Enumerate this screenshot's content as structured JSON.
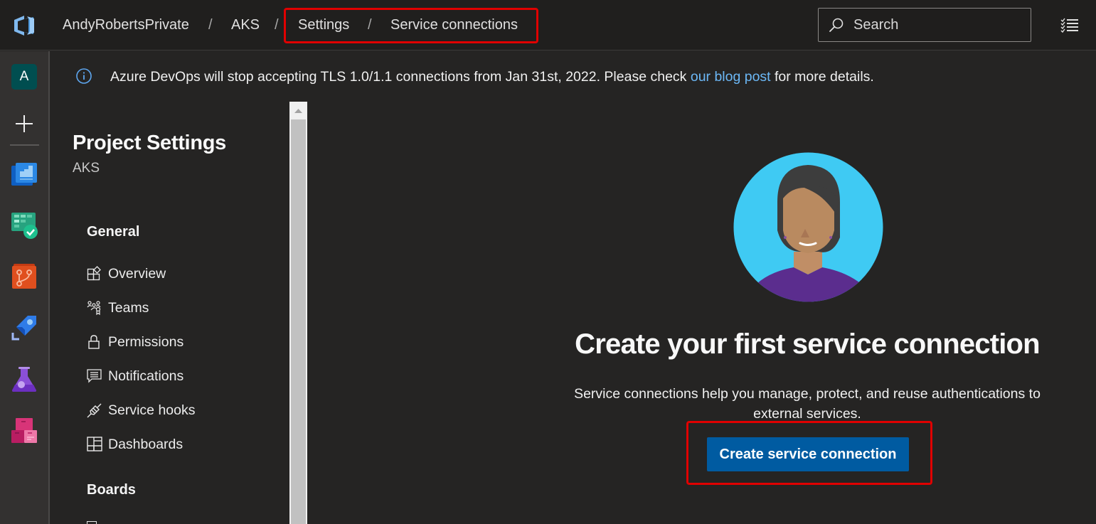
{
  "header": {
    "breadcrumb": [
      {
        "label": "AndyRobertsPrivate"
      },
      {
        "label": "AKS"
      },
      {
        "label": "Settings"
      },
      {
        "label": "Service connections"
      }
    ],
    "separator": "/",
    "search": {
      "placeholder": "Search"
    }
  },
  "rail": {
    "avatar_letter": "A",
    "items": [
      {
        "name": "new",
        "icon": "plus-icon"
      },
      {
        "name": "overview",
        "icon": "overview-icon"
      },
      {
        "name": "boards",
        "icon": "boards-icon"
      },
      {
        "name": "repos",
        "icon": "repos-icon"
      },
      {
        "name": "pipelines",
        "icon": "pipelines-icon"
      },
      {
        "name": "test-plans",
        "icon": "test-plans-icon"
      },
      {
        "name": "artifacts",
        "icon": "artifacts-icon"
      }
    ]
  },
  "banner": {
    "text_before": "Azure DevOps will stop accepting TLS 1.0/1.1 connections from Jan 31st, 2022. Please check ",
    "link": "our blog post",
    "text_after": " for more details."
  },
  "settings_nav": {
    "title": "Project Settings",
    "subtitle": "AKS",
    "groups": [
      {
        "label": "General",
        "items": [
          {
            "label": "Overview",
            "icon": "overview-icon"
          },
          {
            "label": "Teams",
            "icon": "teams-icon"
          },
          {
            "label": "Permissions",
            "icon": "lock-icon"
          },
          {
            "label": "Notifications",
            "icon": "notifications-icon"
          },
          {
            "label": "Service hooks",
            "icon": "service-hooks-icon"
          },
          {
            "label": "Dashboards",
            "icon": "dashboards-icon"
          }
        ]
      },
      {
        "label": "Boards",
        "items": []
      }
    ]
  },
  "main": {
    "title": "Create your first service connection",
    "description": "Service connections help you manage, protect, and reuse authentications to external services.",
    "cta_label": "Create service connection"
  },
  "colors": {
    "accent": "#005ba1",
    "link": "#6cb8f6",
    "highlight": "#e00000",
    "background": "#252423"
  }
}
